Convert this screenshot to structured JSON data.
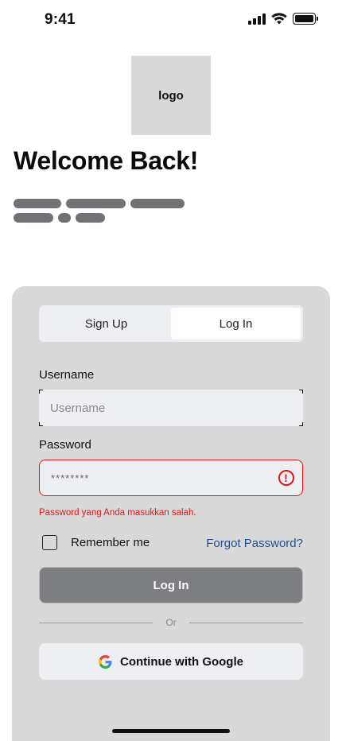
{
  "status_bar": {
    "time": "9:41"
  },
  "logo": {
    "text": "logo"
  },
  "welcome": {
    "title": "Welcome Back!"
  },
  "tabs": [
    {
      "label": "Sign Up",
      "active": false
    },
    {
      "label": "Log In",
      "active": true
    }
  ],
  "username": {
    "label": "Username",
    "placeholder": "Username"
  },
  "password": {
    "label": "Password",
    "value": "********",
    "error": "Password yang Anda masukkan salah."
  },
  "remember": {
    "label": "Remember me",
    "checked": false
  },
  "forgot_password": "Forgot Password?",
  "login_button": "Log In",
  "divider_text": "Or",
  "google_button": "Continue with Google",
  "colors": {
    "card": "#d9d9d9",
    "input": "#eeeff3",
    "error": "#e0161b",
    "link": "#1f4f8f",
    "button": "#7d7e82"
  }
}
